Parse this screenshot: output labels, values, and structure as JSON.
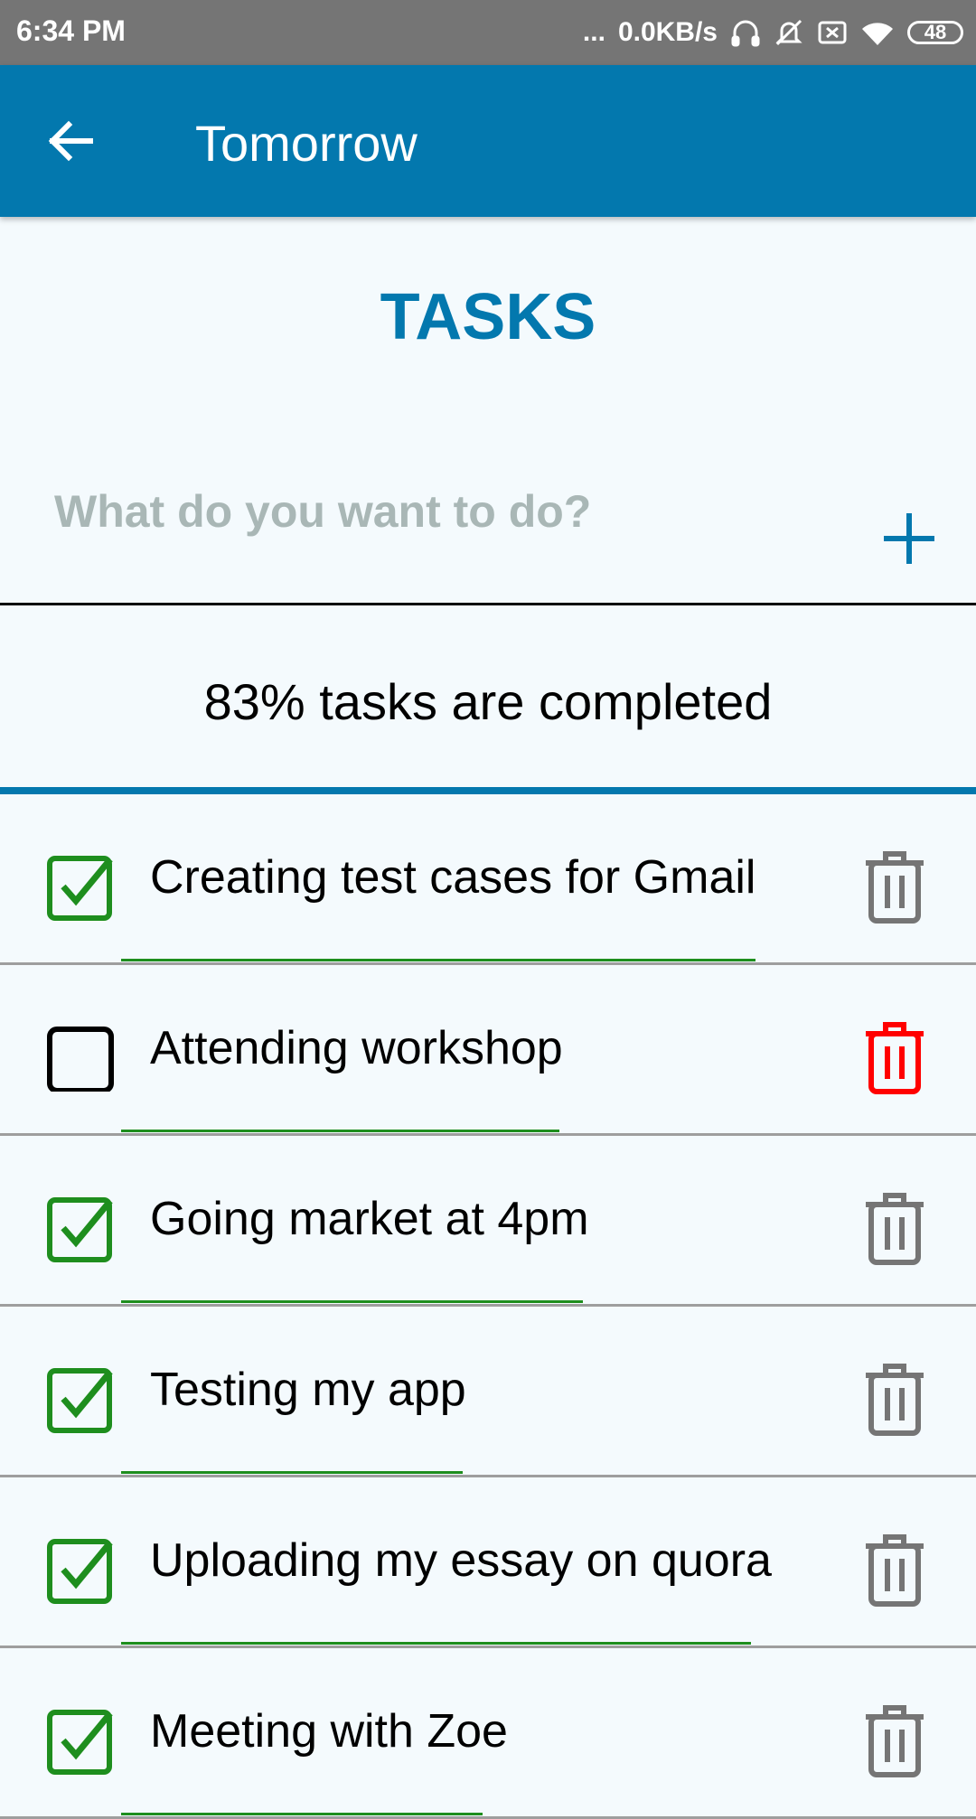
{
  "status_bar": {
    "time": "6:34 PM",
    "dots": "...",
    "network_speed": "0.0KB/s",
    "battery": "48"
  },
  "app_bar": {
    "back_icon": "arrow-left-icon",
    "title": "Tomorrow"
  },
  "heading": "TASKS",
  "input": {
    "placeholder": "What do you want to do?",
    "value": "",
    "add_icon": "plus-icon"
  },
  "progress": {
    "text": "83% tasks are completed",
    "percent": 83
  },
  "tasks": [
    {
      "label": "Creating test cases for Gmail",
      "completed": true
    },
    {
      "label": "Attending workshop",
      "completed": false
    },
    {
      "label": "Going market at 4pm",
      "completed": true
    },
    {
      "label": "Testing my app",
      "completed": true
    },
    {
      "label": "Uploading my essay on quora",
      "completed": true
    },
    {
      "label": "Meeting with Zoe",
      "completed": true
    }
  ],
  "colors": {
    "primary": "#0378AE",
    "check_green": "#1E8E1E",
    "delete_red": "#FF0000",
    "delete_gray": "#757575",
    "placeholder": "#A9B7B6",
    "background": "#F4FAFD"
  }
}
